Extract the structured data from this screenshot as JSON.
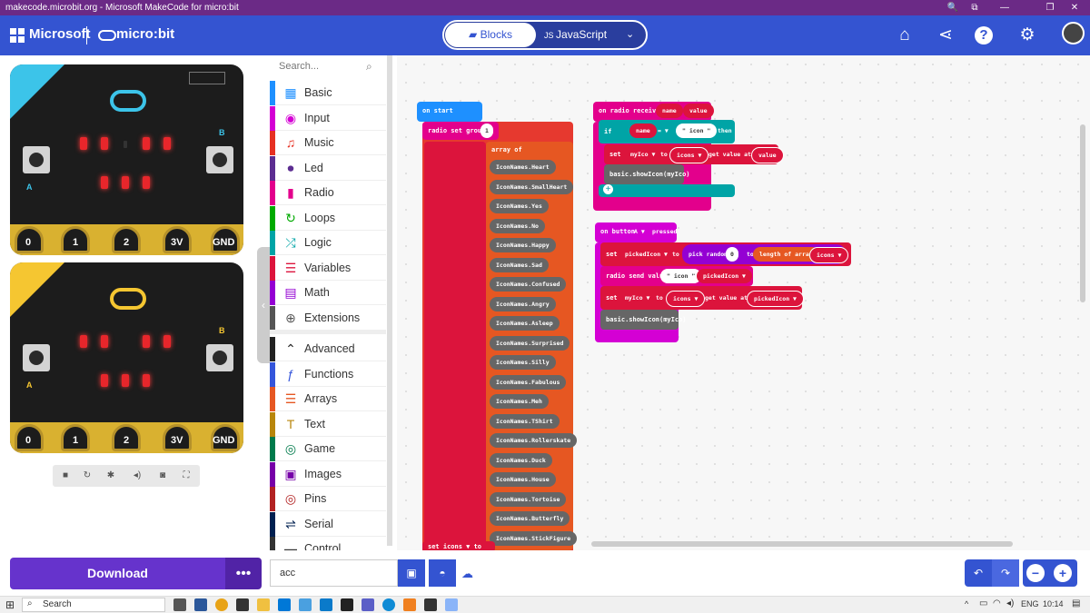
{
  "window": {
    "title": "makecode.microbit.org - Microsoft MakeCode for micro:bit"
  },
  "header": {
    "microsoft": "Microsoft",
    "microbit": "micro:bit",
    "tab_blocks": "Blocks",
    "tab_js": "JavaScript"
  },
  "simulator": {
    "pins": [
      "0",
      "1",
      "2",
      "3V",
      "GND"
    ],
    "btn_a": "A",
    "btn_b": "B"
  },
  "toolbox": {
    "search_placeholder": "Search...",
    "categories": [
      {
        "label": "Basic",
        "color": "#1e90ff",
        "icon": "grid-icon"
      },
      {
        "label": "Input",
        "color": "#d400d4",
        "icon": "target-icon"
      },
      {
        "label": "Music",
        "color": "#e63022",
        "icon": "headphones-icon"
      },
      {
        "label": "Led",
        "color": "#5c2d91",
        "icon": "toggle-icon"
      },
      {
        "label": "Radio",
        "color": "#e3008c",
        "icon": "signal-icon"
      },
      {
        "label": "Loops",
        "color": "#00aa00",
        "icon": "refresh-icon"
      },
      {
        "label": "Logic",
        "color": "#00a4a6",
        "icon": "shuffle-icon"
      },
      {
        "label": "Variables",
        "color": "#dc143c",
        "icon": "list-icon"
      },
      {
        "label": "Math",
        "color": "#9400d3",
        "icon": "calculator-icon"
      },
      {
        "label": "Extensions",
        "color": "#555555",
        "icon": "plus-icon"
      },
      {
        "label": "Advanced",
        "color": "#222222",
        "icon": "chevron-up-icon"
      },
      {
        "label": "Functions",
        "color": "#3455db",
        "icon": "function-icon"
      },
      {
        "label": "Arrays",
        "color": "#e65722",
        "icon": "list-icon"
      },
      {
        "label": "Text",
        "color": "#b8860b",
        "icon": "text-icon"
      },
      {
        "label": "Game",
        "color": "#007a4b",
        "icon": "gamepad-icon"
      },
      {
        "label": "Images",
        "color": "#7600a8",
        "icon": "image-icon"
      },
      {
        "label": "Pins",
        "color": "#b22222",
        "icon": "pin-icon"
      },
      {
        "label": "Serial",
        "color": "#002050",
        "icon": "usb-icon"
      },
      {
        "label": "Control",
        "color": "#333333",
        "icon": "control-icon"
      }
    ]
  },
  "blocks": {
    "on_start": "on start",
    "radio_set_group": "radio set group",
    "group_value": "1",
    "array_of": "array of",
    "icon_names": [
      "IconNames.Heart",
      "IconNames.SmallHeart",
      "IconNames.Yes",
      "IconNames.No",
      "IconNames.Happy",
      "IconNames.Sad",
      "IconNames.Confused",
      "IconNames.Angry",
      "IconNames.Asleep",
      "IconNames.Surprised",
      "IconNames.Silly",
      "IconNames.Fabulous",
      "IconNames.Meh",
      "IconNames.TShirt",
      "IconNames.Rollerskate",
      "IconNames.Duck",
      "IconNames.House",
      "IconNames.Tortoise",
      "IconNames.Butterfly",
      "IconNames.StickFigure"
    ],
    "set_icons": "set  icons ▼  to",
    "on_radio_received": "on radio received",
    "name": "name",
    "value": "value",
    "if": "if",
    "eq": "= ▼",
    "icon_str": "\" icon \"",
    "then": "then",
    "set": "set",
    "myIco": "myIco ▼",
    "to": "to",
    "icons": "icons ▼",
    "get_value_at": "get value at",
    "basic_show_icon": "basic.showIcon(myIco)",
    "on_button": "on button",
    "button_a": "A ▼",
    "pressed": "pressed",
    "pickedIcon": "pickedIcon ▼",
    "pick_random": "pick random",
    "zero": "0",
    "length_of_array": "length of array",
    "radio_send_value": "radio send value",
    "eq2": "=",
    "icon_str2": "\" icon \""
  },
  "bottom": {
    "download": "Download",
    "project_name": "acc"
  },
  "taskbar": {
    "search": "Search",
    "lang": "ENG",
    "time": "10:14"
  }
}
